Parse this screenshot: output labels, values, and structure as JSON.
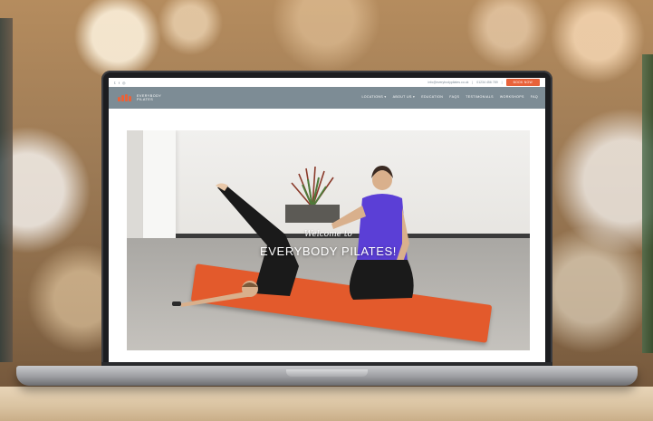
{
  "website": {
    "topbar": {
      "social_icons": [
        "twitter-icon",
        "facebook-icon",
        "instagram-icon"
      ],
      "email": "info@everybodypilates.co.uk",
      "phone": "01234 456 789",
      "book_button": "BOOK NOW"
    },
    "logo": {
      "line1": "EVERYBODY",
      "line2": "PILATES"
    },
    "nav": {
      "items": [
        {
          "label": "LOCATIONS ▾"
        },
        {
          "label": "ABOUT US ▾"
        },
        {
          "label": "EDUCATION"
        },
        {
          "label": "FAQS"
        },
        {
          "label": "TESTIMONIALS"
        },
        {
          "label": "WORKSHOPS"
        },
        {
          "label": "FAQ"
        }
      ]
    },
    "hero": {
      "welcome": "Welcome to",
      "title": "EVERYBODY PILATES!"
    }
  },
  "colors": {
    "accent": "#e8623a",
    "navbar": "#7d8c95",
    "mat": "#e35a2c",
    "shirt": "#5b3fd6"
  }
}
